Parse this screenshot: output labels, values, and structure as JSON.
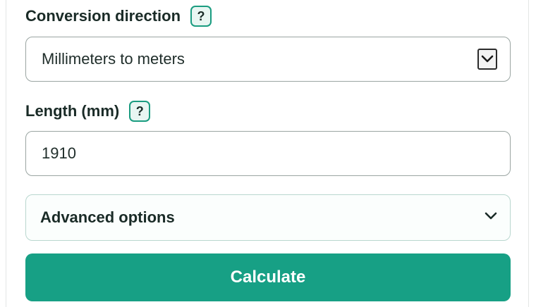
{
  "form": {
    "direction": {
      "label": "Conversion direction",
      "help": "?",
      "selected": "Millimeters to meters"
    },
    "length": {
      "label": "Length (mm)",
      "help": "?",
      "value": "1910"
    },
    "advanced": {
      "label": "Advanced options"
    },
    "calculate_label": "Calculate"
  },
  "colors": {
    "accent": "#17a085",
    "help_bg": "#e8f6f2",
    "border": "#9aa5a2"
  }
}
